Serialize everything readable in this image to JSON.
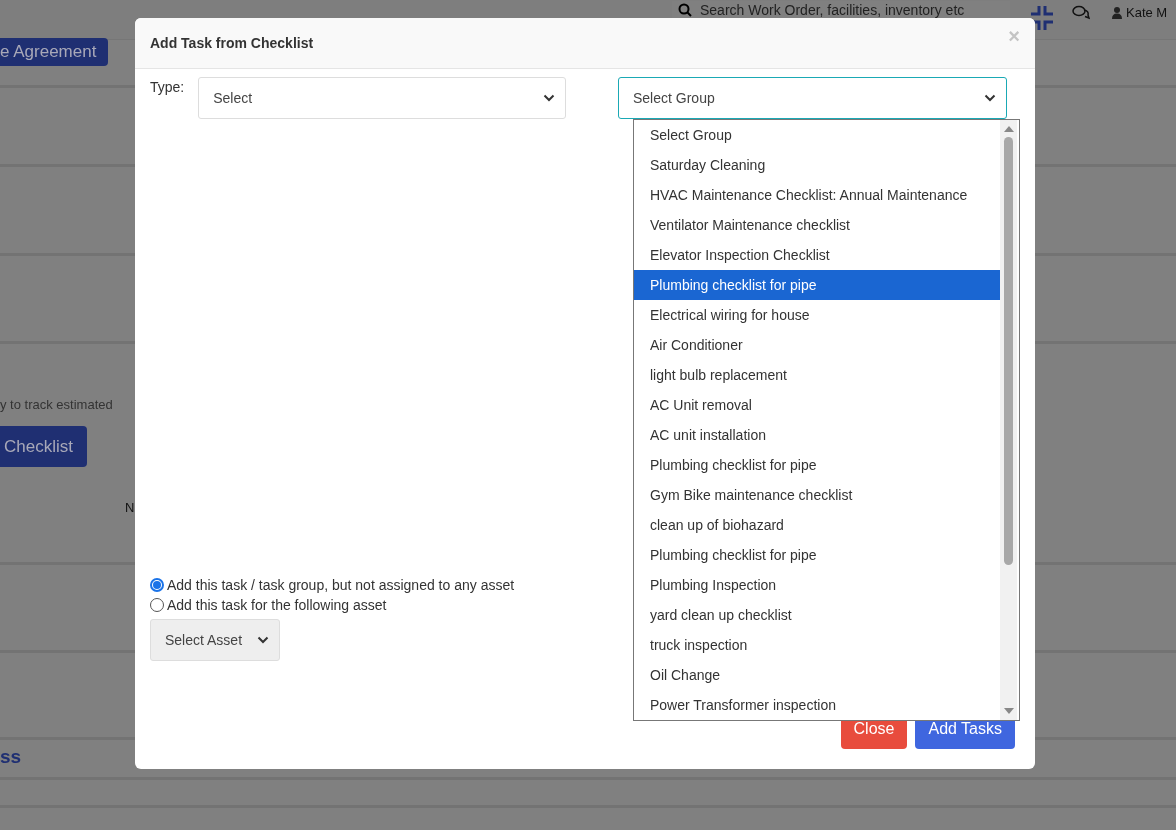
{
  "background": {
    "agreement_button": "e Agreement",
    "search": {
      "placeholder": "Search Work Order, facilities, inventory etc"
    },
    "user": "Kate M",
    "hint_text": "y to track estimated",
    "checklist_button": "Checklist",
    "column_letter": "N",
    "section_heading": "ss"
  },
  "dialog": {
    "title": "Add Task from Checklist",
    "close": "×",
    "type_label": "Type:",
    "type_select": {
      "value": "Select"
    },
    "group_select": {
      "value": "Select Group"
    },
    "group_options": [
      {
        "label": "Select Group",
        "selected": false
      },
      {
        "label": "Saturday Cleaning",
        "selected": false
      },
      {
        "label": "HVAC Maintenance Checklist: Annual Maintenance",
        "selected": false
      },
      {
        "label": "Ventilator Maintenance checklist",
        "selected": false
      },
      {
        "label": "Elevator Inspection Checklist",
        "selected": false
      },
      {
        "label": "Plumbing checklist for pipe",
        "selected": true
      },
      {
        "label": "Electrical wiring for house",
        "selected": false
      },
      {
        "label": "Air Conditioner",
        "selected": false
      },
      {
        "label": "light bulb replacement",
        "selected": false
      },
      {
        "label": "AC Unit removal",
        "selected": false
      },
      {
        "label": "AC unit installation",
        "selected": false
      },
      {
        "label": "Plumbing checklist for pipe",
        "selected": false
      },
      {
        "label": "Gym Bike maintenance checklist",
        "selected": false
      },
      {
        "label": "clean up of biohazard",
        "selected": false
      },
      {
        "label": "Plumbing checklist for pipe",
        "selected": false
      },
      {
        "label": "Plumbing Inspection",
        "selected": false
      },
      {
        "label": "yard clean up checklist",
        "selected": false
      },
      {
        "label": "truck inspection",
        "selected": false
      },
      {
        "label": "Oil Change",
        "selected": false
      },
      {
        "label": "Power Transformer inspection",
        "selected": false
      }
    ],
    "radios": [
      {
        "label": "Add this task / task group, but not assigned to any asset",
        "selected": true
      },
      {
        "label": "Add this task for the following asset",
        "selected": false
      }
    ],
    "asset_select": {
      "value": "Select Asset"
    },
    "buttons": [
      {
        "label": "Close",
        "kind": "danger"
      },
      {
        "label": "Add Tasks",
        "kind": "primary"
      }
    ]
  }
}
